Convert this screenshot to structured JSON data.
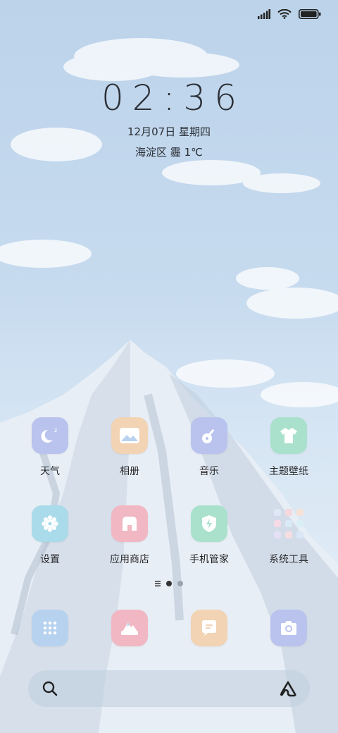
{
  "clock": {
    "time": "02:36"
  },
  "date": {
    "text": "12月07日 星期四"
  },
  "weather": {
    "text": "海淀区 霾 1℃"
  },
  "apps": [
    {
      "label": "天气",
      "icon": "moon-icon",
      "color": "#b9c3ee"
    },
    {
      "label": "相册",
      "icon": "photo-icon",
      "color": "#f2d3b4"
    },
    {
      "label": "音乐",
      "icon": "guitar-icon",
      "color": "#b9c3ee"
    },
    {
      "label": "主题壁纸",
      "icon": "tshirt-icon",
      "color": "#a9e1cc"
    },
    {
      "label": "设置",
      "icon": "gear-icon",
      "color": "#a9dbea"
    },
    {
      "label": "应用商店",
      "icon": "store-icon",
      "color": "#f1b8c3"
    },
    {
      "label": "手机管家",
      "icon": "shield-icon",
      "color": "#a9e1cc"
    },
    {
      "label": "系统工具",
      "icon": "folder-icon",
      "color": "#d9dde6"
    }
  ],
  "dock": [
    {
      "icon": "dialpad-icon",
      "color": "#b7d2ef"
    },
    {
      "icon": "gallery-icon",
      "color": "#f1b8c3"
    },
    {
      "icon": "message-icon",
      "color": "#f2d3b4"
    },
    {
      "icon": "camera-icon",
      "color": "#b9c3ee"
    }
  ],
  "page_indicator": {
    "current": 1,
    "total": 2
  }
}
